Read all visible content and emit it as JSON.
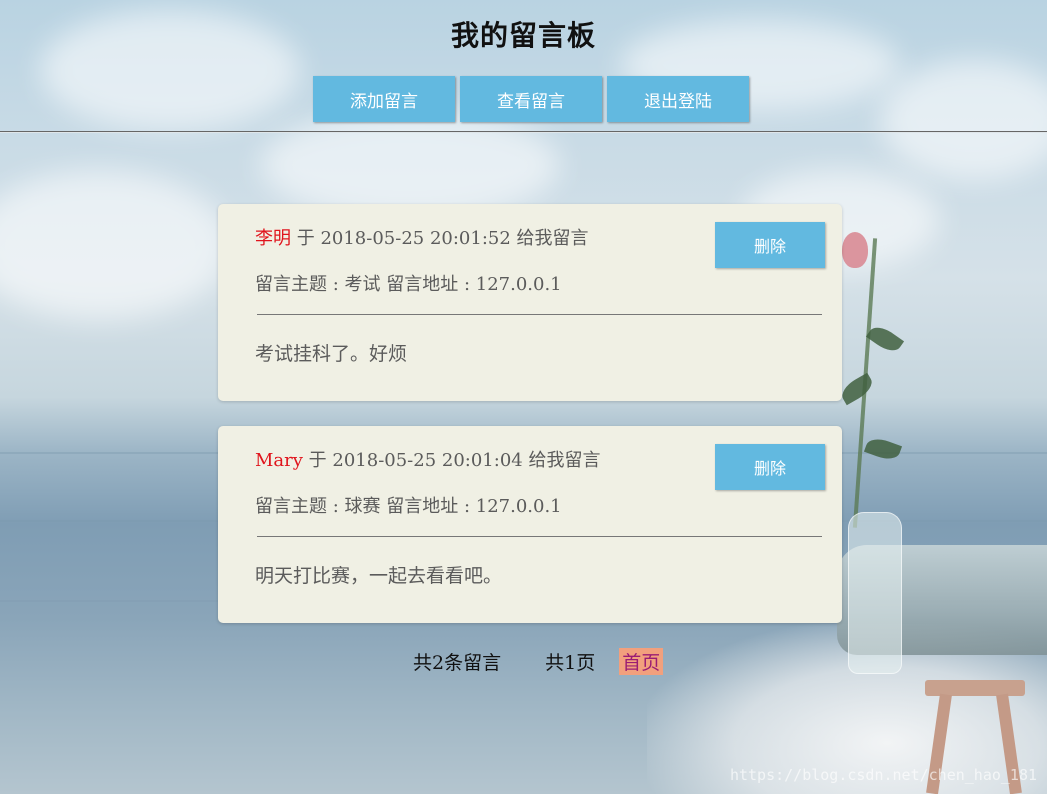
{
  "header": {
    "title": "我的留言板",
    "nav": [
      {
        "label": "添加留言"
      },
      {
        "label": "查看留言"
      },
      {
        "label": "退出登陆"
      }
    ]
  },
  "messages": [
    {
      "author": "李明",
      "meta": " 于 2018-05-25 20:01:52 给我留言",
      "subject_line": "留言主题 : 考试 留言地址 : 127.0.0.1",
      "content": "考试挂科了。好烦",
      "delete_label": "删除"
    },
    {
      "author": "Mary",
      "meta": " 于 2018-05-25 20:01:04 给我留言",
      "subject_line": "留言主题 : 球赛 留言地址 : 127.0.0.1",
      "content": "明天打比赛，一起去看看吧。",
      "delete_label": "删除"
    }
  ],
  "pagination": {
    "total_messages": "共2条留言",
    "total_pages": "共1页",
    "first_page": "首页"
  },
  "watermark": "https://blog.csdn.net/chen_hao_181",
  "colors": {
    "button": "#62b9e0",
    "card": "#f0f0e4",
    "author": "#e0141c",
    "first_page_bg": "#f2a07d"
  }
}
